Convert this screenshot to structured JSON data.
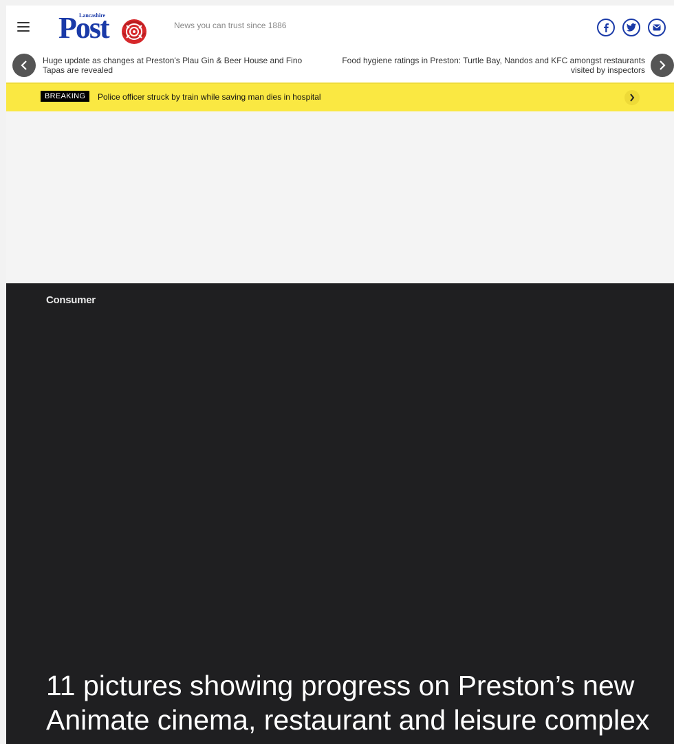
{
  "header": {
    "logo": {
      "small_text": "Lancashire",
      "main_text": "Post"
    },
    "tagline": "News you can trust since 1886",
    "social": [
      {
        "name": "facebook",
        "icon": "facebook-icon"
      },
      {
        "name": "twitter",
        "icon": "twitter-icon"
      },
      {
        "name": "email",
        "icon": "mail-icon"
      }
    ]
  },
  "ticker": {
    "items": [
      {
        "text": "Huge update as changes at Preston's Plau Gin & Beer House and Fino Tapas are revealed"
      },
      {
        "text": "Food hygiene ratings in Preston: Turtle Bay, Nandos and KFC amongst restaurants visited by inspectors"
      }
    ]
  },
  "breaking": {
    "badge": "BREAKING",
    "text": "Police officer struck by train while saving man dies in hospital"
  },
  "article": {
    "category": "Consumer",
    "headline": "11 pictures showing progress on Preston’s new Animate cinema, restaurant and leisure complex"
  },
  "colors": {
    "brand_blue": "#1a3aa8",
    "rose_red": "#d6282b",
    "breaking_yellow": "#fae842",
    "hero_dark": "#1f1f21"
  }
}
